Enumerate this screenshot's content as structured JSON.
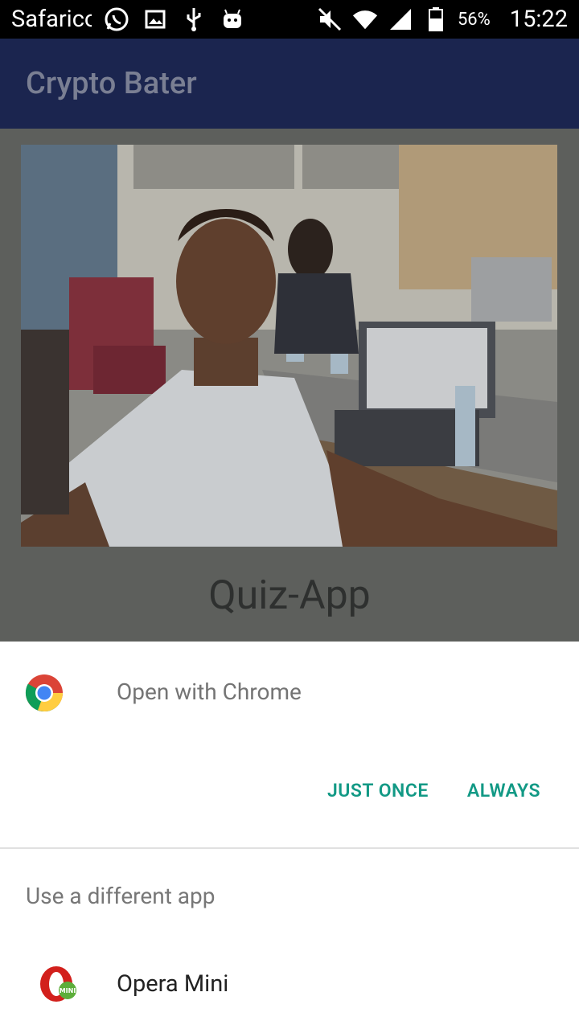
{
  "status_bar": {
    "carrier": "Safaricom",
    "battery_percent": "56%",
    "time": "15:22"
  },
  "app_bar": {
    "title": "Crypto Bater"
  },
  "main": {
    "title": "Quiz-App"
  },
  "dialog": {
    "open_with": "Open with Chrome",
    "just_once": "JUST ONCE",
    "always": "ALWAYS",
    "different_app": "Use a different app",
    "apps": [
      {
        "label": "Opera Mini",
        "icon": "opera-mini-icon"
      }
    ]
  },
  "colors": {
    "app_bar": "#1b254f",
    "accent": "#129985",
    "status_bar": "#000000"
  }
}
